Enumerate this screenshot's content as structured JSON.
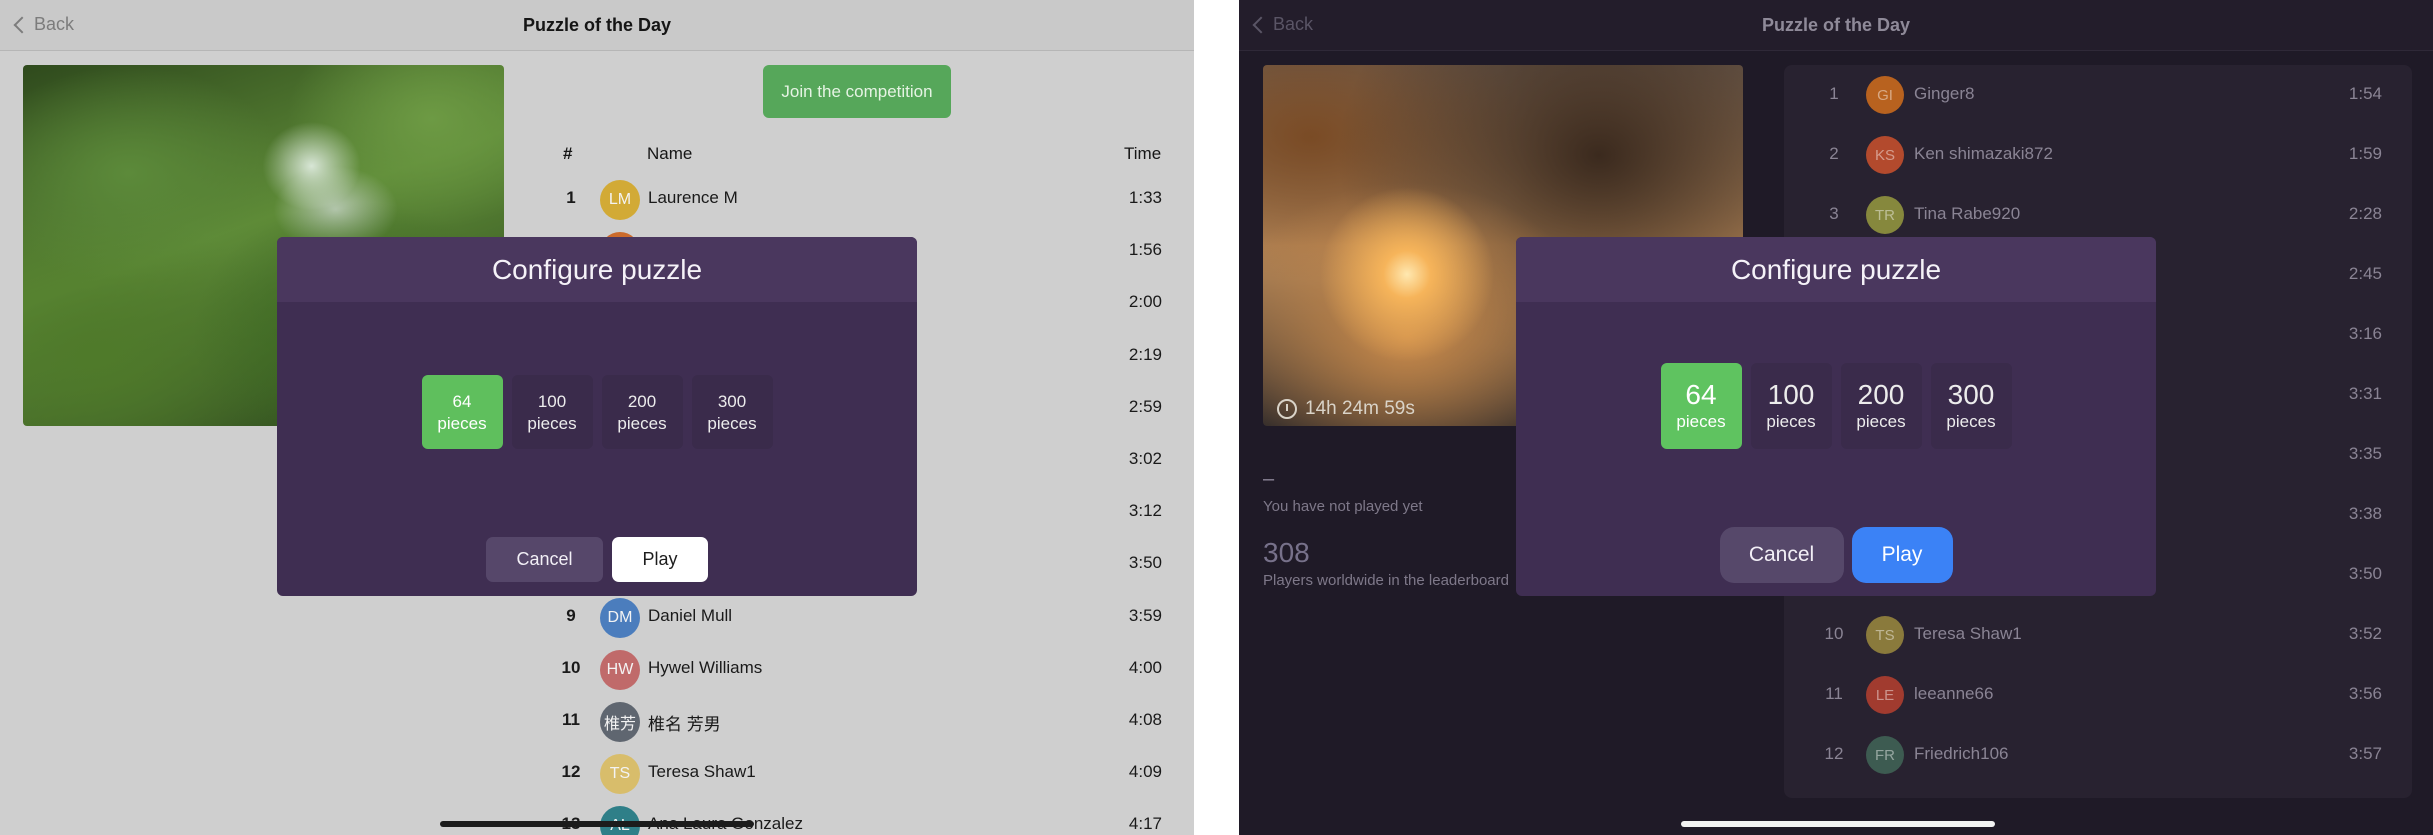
{
  "light": {
    "nav": {
      "back_label": "Back",
      "title": "Puzzle of the Day"
    },
    "join_label": "Join the competition",
    "headers": {
      "rank": "#",
      "name": "Name",
      "time": "Time"
    },
    "rows": [
      {
        "rank": "1",
        "initials": "LM",
        "name": "Laurence M",
        "time": "1:33",
        "color": "#d2aa36"
      },
      {
        "rank": "",
        "initials": "",
        "name": "",
        "time": "1:56",
        "color": "#cc6b2c"
      },
      {
        "rank": "",
        "initials": "",
        "name": "",
        "time": "2:00",
        "color": ""
      },
      {
        "rank": "",
        "initials": "",
        "name": "",
        "time": "2:19",
        "color": ""
      },
      {
        "rank": "",
        "initials": "",
        "name": "",
        "time": "2:59",
        "color": ""
      },
      {
        "rank": "",
        "initials": "",
        "name": "",
        "time": "3:02",
        "color": ""
      },
      {
        "rank": "",
        "initials": "",
        "name": "",
        "time": "3:12",
        "color": ""
      },
      {
        "rank": "",
        "initials": "",
        "name": "",
        "time": "3:50",
        "color": ""
      },
      {
        "rank": "9",
        "initials": "DM",
        "name": "Daniel Mull",
        "time": "3:59",
        "color": "#4b7dbd"
      },
      {
        "rank": "10",
        "initials": "HW",
        "name": "Hywel Williams",
        "time": "4:00",
        "color": "#c06a6a"
      },
      {
        "rank": "11",
        "initials": "椎芳",
        "name": "椎名 芳男",
        "time": "4:08",
        "color": "#5f6670"
      },
      {
        "rank": "12",
        "initials": "TS",
        "name": "Teresa Shaw1",
        "time": "4:09",
        "color": "#d8bd6b"
      },
      {
        "rank": "13",
        "initials": "AL",
        "name": "Ana Laura Gonzalez",
        "time": "4:17",
        "color": "#2f7f88"
      }
    ],
    "modal": {
      "title": "Configure puzzle",
      "options": [
        {
          "n": "64",
          "p": "pieces"
        },
        {
          "n": "100",
          "p": "pieces"
        },
        {
          "n": "200",
          "p": "pieces"
        },
        {
          "n": "300",
          "p": "pieces"
        }
      ],
      "cancel": "Cancel",
      "play": "Play"
    }
  },
  "dark": {
    "nav": {
      "back_label": "Back",
      "title": "Puzzle of the Day"
    },
    "timer": "14h 24m 59s",
    "stats": {
      "dash": "–",
      "not_played": "You have not played yet",
      "players": "308",
      "players_label": "Players worldwide in the leaderboard"
    },
    "rows": [
      {
        "rank": "1",
        "initials": "GI",
        "name": "Ginger8",
        "time": "1:54",
        "color": "#b8621f"
      },
      {
        "rank": "2",
        "initials": "KS",
        "name": "Ken shimazaki872",
        "time": "1:59",
        "color": "#b34a2d"
      },
      {
        "rank": "3",
        "initials": "TR",
        "name": "Tina Rabe920",
        "time": "2:28",
        "color": "#86883d"
      },
      {
        "rank": "",
        "initials": "",
        "name": "",
        "time": "2:45",
        "color": ""
      },
      {
        "rank": "",
        "initials": "",
        "name": "",
        "time": "3:16",
        "color": ""
      },
      {
        "rank": "",
        "initials": "",
        "name": "",
        "time": "3:31",
        "color": ""
      },
      {
        "rank": "",
        "initials": "",
        "name": "",
        "time": "3:35",
        "color": ""
      },
      {
        "rank": "",
        "initials": "",
        "name": "",
        "time": "3:38",
        "color": ""
      },
      {
        "rank": "",
        "initials": "",
        "name": "",
        "time": "3:50",
        "color": ""
      },
      {
        "rank": "10",
        "initials": "TS",
        "name": "Teresa Shaw1",
        "time": "3:52",
        "color": "#8a7a3c"
      },
      {
        "rank": "11",
        "initials": "LE",
        "name": "leeanne66",
        "time": "3:56",
        "color": "#a13b2f"
      },
      {
        "rank": "12",
        "initials": "FR",
        "name": "Friedrich106",
        "time": "3:57",
        "color": "#3d5b51"
      }
    ],
    "modal": {
      "title": "Configure puzzle",
      "options": [
        {
          "n": "64",
          "p": "pieces"
        },
        {
          "n": "100",
          "p": "pieces"
        },
        {
          "n": "200",
          "p": "pieces"
        },
        {
          "n": "300",
          "p": "pieces"
        }
      ],
      "cancel": "Cancel",
      "play": "Play"
    }
  }
}
